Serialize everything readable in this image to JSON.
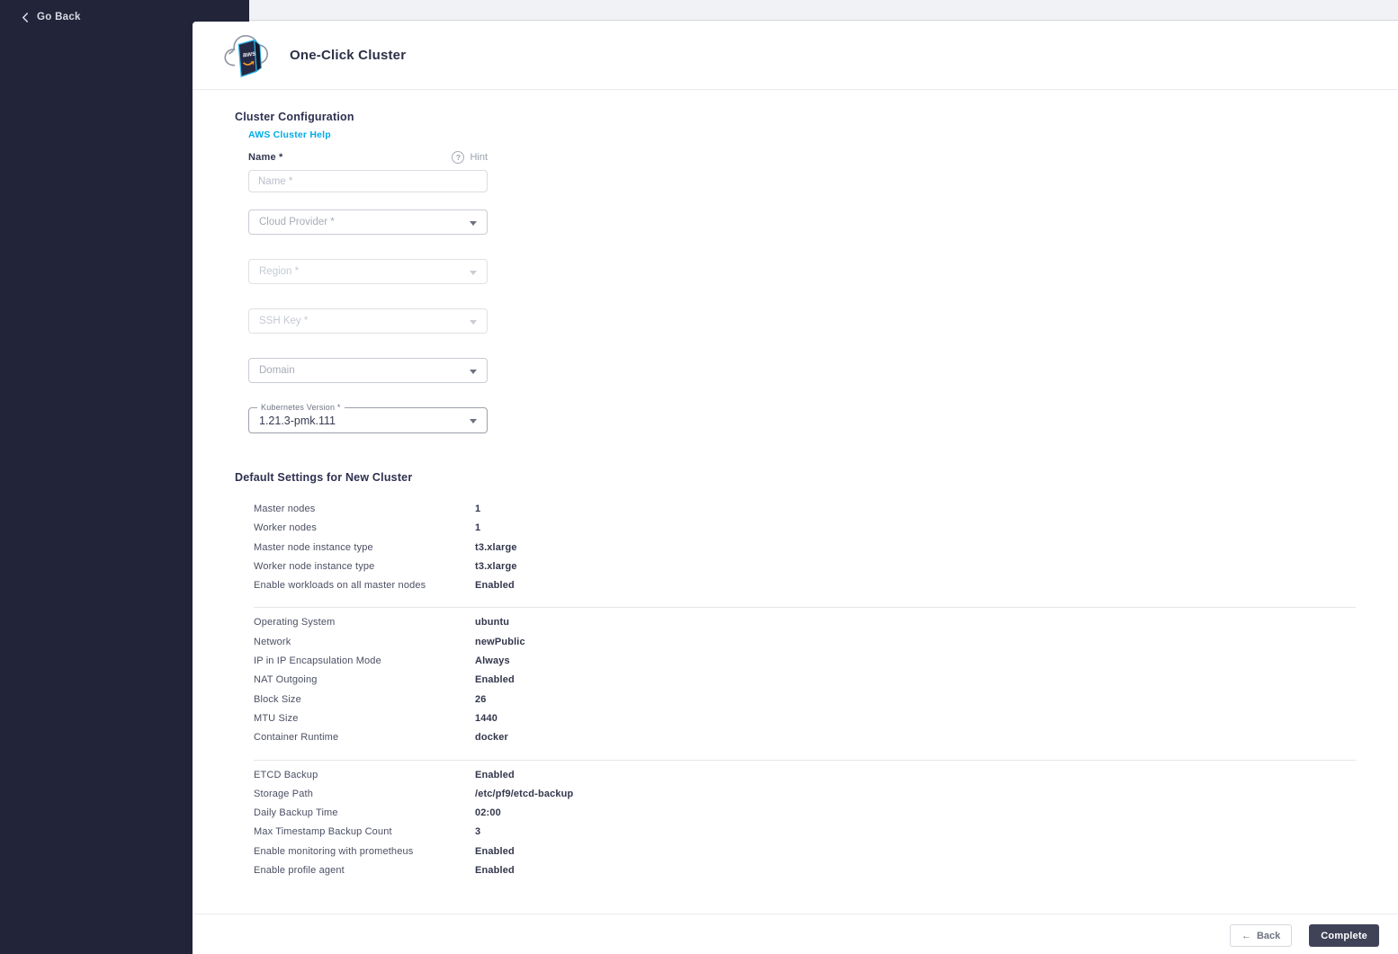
{
  "sidebar": {
    "go_back_label": "Go Back",
    "back_chevron_icon": "chevron-left"
  },
  "header": {
    "title": "One-Click Cluster",
    "icon": "aws-cloud-icon"
  },
  "form": {
    "section_title": "Cluster Configuration",
    "help_link": "AWS Cluster Help",
    "name_label": "Name *",
    "hint_label": "Hint",
    "hint_icon": "question-circle-icon",
    "name_placeholder": "Name *",
    "name_value": "",
    "selects": [
      {
        "id": "cloud-provider",
        "placeholder": "Cloud Provider *",
        "state": "enabled"
      },
      {
        "id": "region",
        "placeholder": "Region *",
        "state": "disabled"
      },
      {
        "id": "ssh-key",
        "placeholder": "SSH Key *",
        "state": "disabled"
      },
      {
        "id": "domain",
        "placeholder": "Domain",
        "state": "enabled"
      }
    ],
    "kubernetes": {
      "label": "Kubernetes Version *",
      "value": "1.21.3-pmk.111"
    }
  },
  "defaults": {
    "section_title": "Default Settings for New Cluster",
    "groups": [
      {
        "rows": [
          {
            "label": "Master nodes",
            "value": "1"
          },
          {
            "label": "Worker nodes",
            "value": "1"
          },
          {
            "label": "Master node instance type",
            "value": "t3.xlarge"
          },
          {
            "label": "Worker node instance type",
            "value": "t3.xlarge"
          },
          {
            "label": "Enable workloads on all master nodes",
            "value": "Enabled"
          }
        ]
      },
      {
        "rows": [
          {
            "label": "Operating System",
            "value": "ubuntu"
          },
          {
            "label": "Network",
            "value": "newPublic"
          },
          {
            "label": "IP in IP Encapsulation Mode",
            "value": "Always"
          },
          {
            "label": "NAT Outgoing",
            "value": "Enabled"
          },
          {
            "label": "Block Size",
            "value": "26"
          },
          {
            "label": "MTU Size",
            "value": "1440"
          },
          {
            "label": "Container Runtime",
            "value": "docker"
          }
        ]
      },
      {
        "rows": [
          {
            "label": "ETCD Backup",
            "value": "Enabled"
          },
          {
            "label": "Storage Path",
            "value": "/etc/pf9/etcd-backup"
          },
          {
            "label": "Daily Backup Time",
            "value": "02:00"
          },
          {
            "label": "Max Timestamp Backup Count",
            "value": "3"
          },
          {
            "label": "Enable monitoring with prometheus",
            "value": "Enabled"
          },
          {
            "label": "Enable profile agent",
            "value": "Enabled"
          }
        ]
      }
    ]
  },
  "footer": {
    "back_label": "Back",
    "back_arrow_icon": "arrow-left",
    "complete_label": "Complete"
  },
  "colors": {
    "sidebar_bg": "#22243a",
    "accent_cyan": "#00abe8",
    "complete_button_bg": "#404357",
    "topbar_bg": "#f1f2f6"
  }
}
